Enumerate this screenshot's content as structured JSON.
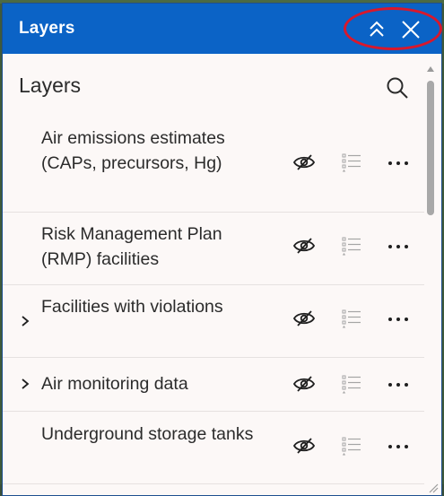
{
  "header": {
    "title": "Layers",
    "icons": {
      "collapse": "chevrons-up-icon",
      "close": "close-icon"
    }
  },
  "panel": {
    "heading": "Layers",
    "search_icon": "search-icon"
  },
  "layers": [
    {
      "title": "Air emissions estimates (CAPs, precursors, Hg)",
      "expandable": false,
      "visible": false
    },
    {
      "title": "Risk Management Plan (RMP) facilities",
      "expandable": false,
      "visible": false
    },
    {
      "title": "Facilities with violations",
      "expandable": true,
      "visible": false
    },
    {
      "title": "Air monitoring data",
      "expandable": true,
      "visible": false
    },
    {
      "title": "Underground storage tanks",
      "expandable": false,
      "visible": false
    }
  ],
  "colors": {
    "header_bg": "#0b63c6",
    "content_bg": "#fcf8f7",
    "highlight": "#d8182c",
    "text": "#2b2b2b"
  }
}
